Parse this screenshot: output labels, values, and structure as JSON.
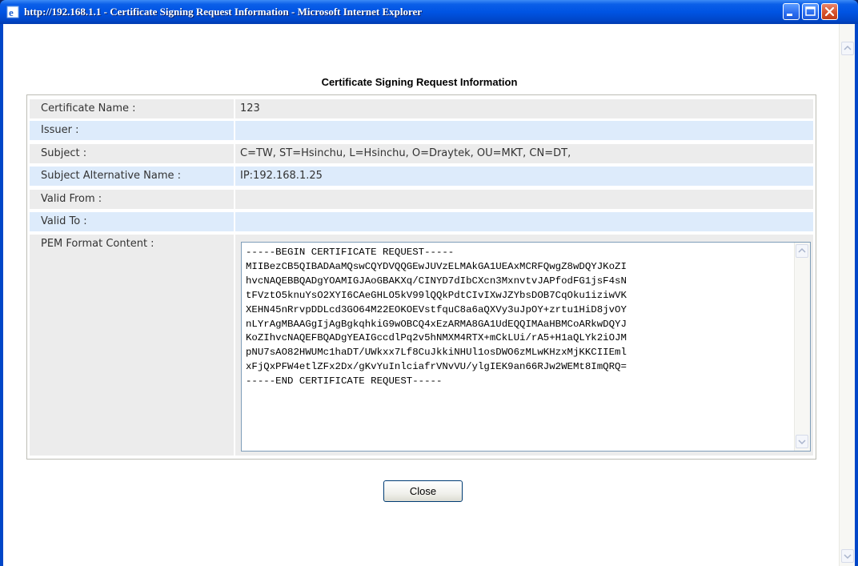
{
  "window": {
    "title": "http://192.168.1.1 - Certificate Signing Request Information - Microsoft Internet Explorer",
    "titlebar_color": "#0054e3",
    "close_color": "#d6522c"
  },
  "page": {
    "heading": "Certificate Signing Request Information"
  },
  "fields": [
    {
      "label": "Certificate Name :",
      "value": "123"
    },
    {
      "label": "Issuer :",
      "value": ""
    },
    {
      "label": "Subject :",
      "value": "C=TW, ST=Hsinchu, L=Hsinchu, O=Draytek, OU=MKT, CN=DT,"
    },
    {
      "label": "Subject Alternative Name :",
      "value": "IP:192.168.1.25"
    },
    {
      "label": "Valid From :",
      "value": ""
    },
    {
      "label": "Valid To :",
      "value": ""
    }
  ],
  "pem": {
    "label": "PEM Format Content :",
    "content": "-----BEGIN CERTIFICATE REQUEST-----\nMIIBezCB5QIBADAaMQswCQYDVQQGEwJUVzELMAkGA1UEAxMCRFQwgZ8wDQYJKoZI\nhvcNAQEBBQADgYOAMIGJAoGBAKXq/CINYD7dIbCXcn3MxnvtvJAPfodFG1jsF4sN\ntFVztO5knuYsO2XYI6CAeGHLO5kV99lQQkPdtCIvIXwJZYbsDOB7CqOku1iziwVK\nXEHN45nRrvpDDLcd3GO64M22EOKOEVstfquC8a6aQXVy3uJpOY+zrtu1HiD8jvOY\nnLYrAgMBAAGgIjAgBgkqhkiG9wOBCQ4xEzARMA8GA1UdEQQIMAaHBMCoARkwDQYJ\nKoZIhvcNAQEFBQADgYEAIGccdlPq2v5hNMXM4RTX+mCkLUi/rA5+H1aQLYk2iOJM\npNU7sAO82HWUMc1haDT/UWkxx7Lf8CuJkkiNHUl1osDWO6zMLwKHzxMjKKCIIEml\nxFjQxPFW4etlZFx2Dx/gKvYuInlciafrVNvVU/ylgIEK9an66RJw2WEMt8ImQRQ=\n-----END CERTIFICATE REQUEST-----"
  },
  "actions": {
    "close_label": "Close"
  },
  "icons": {
    "ie_icon": "internet-explorer-icon",
    "minimize": "minimize-icon",
    "maximize": "maximize-icon",
    "close": "close-icon",
    "scroll_up": "chevron-up-icon",
    "scroll_down": "chevron-down-icon"
  },
  "colors": {
    "row_grey": "#ececec",
    "row_blue": "#ddebfb"
  }
}
